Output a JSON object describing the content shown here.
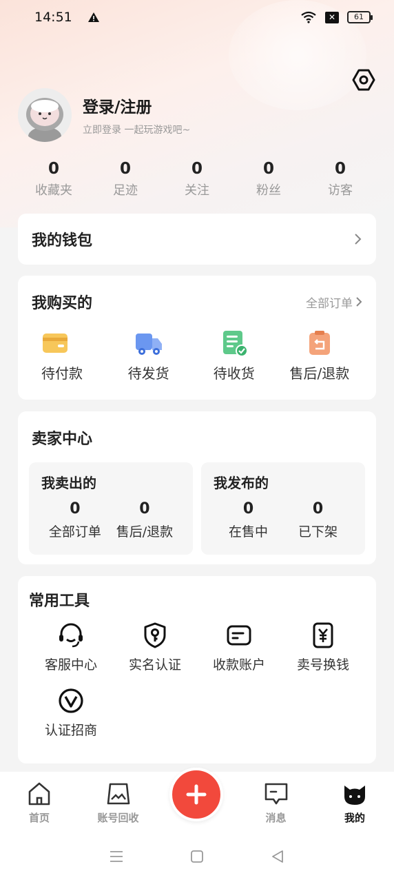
{
  "status_bar": {
    "time": "14:51",
    "battery": "61"
  },
  "profile": {
    "title": "登录/注册",
    "subtitle": "立即登录 一起玩游戏吧~"
  },
  "stats": [
    {
      "value": "0",
      "label": "收藏夹"
    },
    {
      "value": "0",
      "label": "足迹"
    },
    {
      "value": "0",
      "label": "关注"
    },
    {
      "value": "0",
      "label": "粉丝"
    },
    {
      "value": "0",
      "label": "访客"
    }
  ],
  "wallet": {
    "title": "我的钱包"
  },
  "purchase": {
    "title": "我购买的",
    "all_orders": "全部订单",
    "items": [
      {
        "label": "待付款",
        "icon": "wallet-icon"
      },
      {
        "label": "待发货",
        "icon": "truck-icon"
      },
      {
        "label": "待收货",
        "icon": "receipt-check-icon"
      },
      {
        "label": "售后/退款",
        "icon": "refund-icon"
      }
    ]
  },
  "seller": {
    "title": "卖家中心",
    "sold": {
      "title": "我卖出的",
      "stats": [
        {
          "value": "0",
          "label": "全部订单"
        },
        {
          "value": "0",
          "label": "售后/退款"
        }
      ]
    },
    "published": {
      "title": "我发布的",
      "stats": [
        {
          "value": "0",
          "label": "在售中"
        },
        {
          "value": "0",
          "label": "已下架"
        }
      ]
    }
  },
  "tools": {
    "title": "常用工具",
    "items": [
      {
        "label": "客服中心",
        "icon": "headset-icon"
      },
      {
        "label": "实名认证",
        "icon": "shield-key-icon"
      },
      {
        "label": "收款账户",
        "icon": "card-icon"
      },
      {
        "label": "卖号换钱",
        "icon": "yen-icon"
      },
      {
        "label": "认证招商",
        "icon": "v-badge-icon"
      }
    ]
  },
  "nav": {
    "items": [
      {
        "label": "首页",
        "icon": "home-icon",
        "active": false
      },
      {
        "label": "账号回收",
        "icon": "recycle-box-icon",
        "active": false
      },
      {
        "label": "消息",
        "icon": "message-icon",
        "active": false
      },
      {
        "label": "我的",
        "icon": "cat-icon",
        "active": true
      }
    ],
    "publish_icon": "plus-icon"
  },
  "colors": {
    "accent": "#f2493c",
    "muted": "#999999",
    "background": "#f4f4f4"
  }
}
